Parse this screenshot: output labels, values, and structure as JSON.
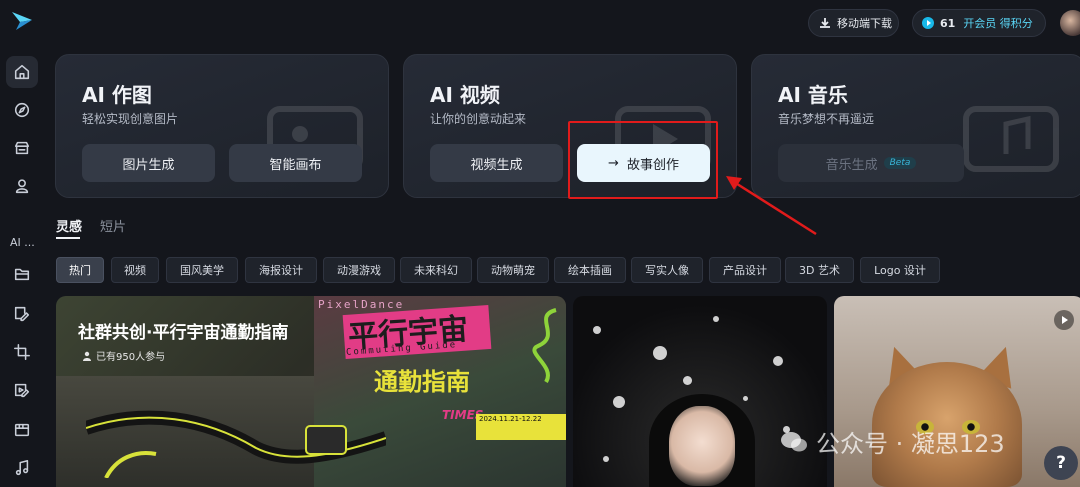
{
  "header": {
    "download_label": "移动端下载",
    "credits_count": "61",
    "credits_link": "开会员 得积分"
  },
  "sidebar": {
    "truncated_label": "AI ..."
  },
  "cards": [
    {
      "title": "AI 作图",
      "subtitle": "轻松实现创意图片",
      "buttons": [
        "图片生成",
        "智能画布"
      ]
    },
    {
      "title": "AI 视频",
      "subtitle": "让你的创意动起来",
      "buttons": [
        "视频生成",
        "故事创作"
      ]
    },
    {
      "title": "AI 音乐",
      "subtitle": "音乐梦想不再遥远",
      "buttons": [
        "音乐生成"
      ],
      "badge": "Beta"
    }
  ],
  "tabs": [
    "灵感",
    "短片"
  ],
  "chips": [
    "热门",
    "视频",
    "国风美学",
    "海报设计",
    "动漫游戏",
    "未来科幻",
    "动物萌宠",
    "绘本插画",
    "写实人像",
    "产品设计",
    "3D 艺术",
    "Logo 设计"
  ],
  "gallery": {
    "featured_title": "社群共创·平行宇宙通勤指南",
    "featured_subtitle": "已有950人参与",
    "poster_brand": "PixelDance",
    "poster_title": "平行宇宙",
    "poster_guide": "Commuting Guide",
    "poster_yellow": "通勤指南",
    "poster_times": "TIMES",
    "poster_date": "2024.11.21-12.22"
  },
  "watermark": "公众号 · 凝思123",
  "help_label": "?",
  "colors": {
    "accent": "#5ad6f6",
    "highlight_red": "#e11b1b",
    "background": "#14161c"
  }
}
